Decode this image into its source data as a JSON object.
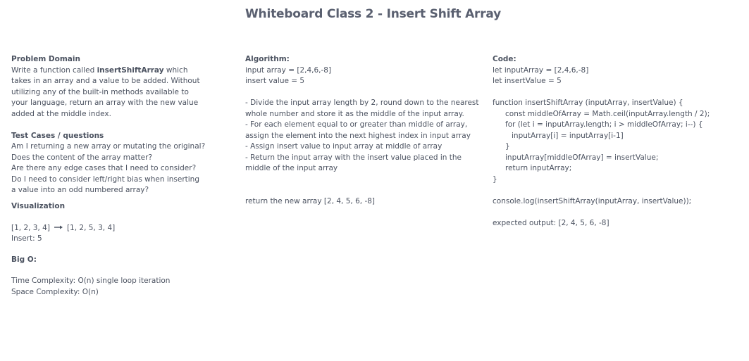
{
  "title": "Whiteboard Class 2 - Insert Shift Array",
  "problem": {
    "heading": "Problem Domain",
    "line1_pre": "Write a function  called ",
    "line1_bold": "insertShiftArray",
    "line1_post": " which",
    "lines": [
      "takes in an array and a value to be added. Without",
      "utilizing any of the built-in methods available to",
      "your language, return an array with the new value",
      "added at the middle index."
    ]
  },
  "tests": {
    "heading": "Test Cases / questions",
    "lines": [
      "Am I returning a new array or mutating the original?",
      "Does the content of the array matter?",
      "Are there any edge cases that I need to consider?",
      "Do I need to consider left/right bias when inserting",
      "a value into an odd numbered array?"
    ]
  },
  "visualization": {
    "heading": "Visualization",
    "before": "[1, 2, 3, 4]",
    "after": "[1, 2, 5, 3, 4]",
    "insert": "Insert: 5"
  },
  "bigo": {
    "heading": "Big O:",
    "time": "Time Complexity: O(n) single loop iteration",
    "space": "Space Complexity: O(n)"
  },
  "algorithm": {
    "heading": "Algorithm:",
    "input_array": "input array = [2,4,6,-8]",
    "insert_value": "insert value = 5",
    "steps": [
      "- Divide the input array length by 2, round down to the nearest whole number and store it as the middle of the input array.",
      "- For each element equal to or greater than middle of array, assign the element into the next highest index in input array",
      "- Assign insert value to input array at middle of array",
      "- Return the input array with the insert value placed in the middle of the input array"
    ],
    "result": "return the new array [2, 4, 5, 6, -8]"
  },
  "code": {
    "heading": "Code:",
    "decl1": "let inputArray = [2,4,6,-8]",
    "decl2": "let insertValue = 5",
    "fn_open": "function insertShiftArray (inputArray, insertValue) {",
    "fn_mid": "const middleOfArray = Math.ceil(inputArray.length / 2);",
    "fn_for": "for (let i = inputArray.length; i > middleOfArray; i--) {",
    "fn_assign": "inputArray[i] = inputArray[i-1]",
    "fn_close_for": "}",
    "fn_insert": "inputArray[middleOfArray] = insertValue;",
    "fn_return": "return inputArray;",
    "fn_close": "}",
    "log": "console.log(insertShiftArray(inputArray, insertValue));",
    "expected": "expected output: [2, 4, 5, 6, -8]"
  },
  "colors": {
    "text": "#4b5260",
    "title": "#5a6070"
  }
}
